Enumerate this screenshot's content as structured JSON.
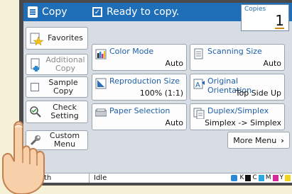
{
  "header": {
    "title": "Copy",
    "status": "Ready to copy."
  },
  "copies": {
    "label": "Copies",
    "value": "1"
  },
  "left_menu": {
    "favorites": "Favorites",
    "additional_copy": "Additional Copy",
    "sample_copy": "Sample Copy",
    "check_setting": "Check Setting",
    "custom_menu": "Custom Menu"
  },
  "tiles": {
    "color_mode": {
      "title": "Color Mode",
      "value": "Auto"
    },
    "scanning_size": {
      "title": "Scanning Size",
      "value": "Auto"
    },
    "reproduction_size": {
      "title": "Reproduction Size",
      "value": "100% (1:1)"
    },
    "original_orientation": {
      "title": "Original Orientation",
      "value": "Top Side Up"
    },
    "paper_selection": {
      "title": "Paper Selection",
      "value": "Auto"
    },
    "duplex_simplex": {
      "title": "Duplex/Simplex",
      "value": "Simplex -> Simplex"
    }
  },
  "more_menu": "More Menu",
  "footer": {
    "user": "J.Smith",
    "status": "Idle",
    "toner": [
      "K",
      "C",
      "M",
      "Y"
    ]
  },
  "colors": {
    "accent": "#1f6fb8",
    "background": "#f5f0d6"
  }
}
